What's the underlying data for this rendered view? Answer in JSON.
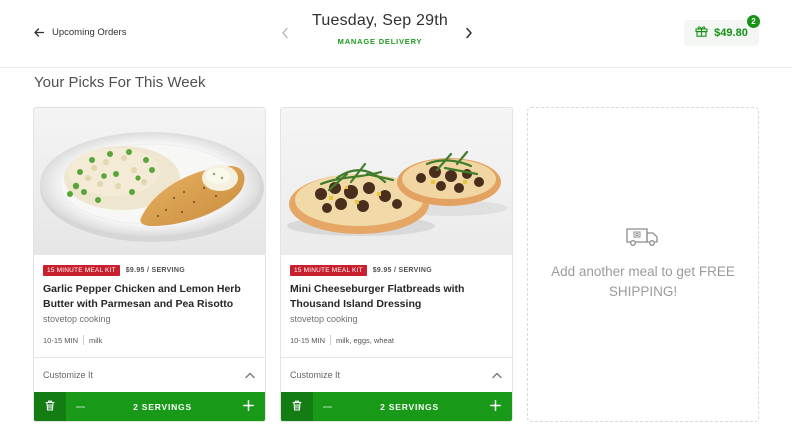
{
  "header": {
    "back_label": "Upcoming Orders",
    "date": "Tuesday, Sep 29th",
    "manage_label": "MANAGE DELIVERY",
    "cart_total": "$49.80",
    "cart_count": "2"
  },
  "section_title": "Your Picks For This Week",
  "meals": [
    {
      "badge": "15 MINUTE MEAL KIT",
      "price": "$9.95 / SERVING",
      "name": "Garlic Pepper Chicken and Lemon Herb Butter with Parmesan and Pea Risotto",
      "subtitle": "stovetop cooking",
      "time": "10-15 MIN",
      "allergens": "milk",
      "customize_label": "Customize It",
      "servings": "2 SERVINGS"
    },
    {
      "badge": "15 MINUTE MEAL KIT",
      "price": "$9.95 / SERVING",
      "name": "Mini Cheeseburger Flatbreads with Thousand Island Dressing",
      "subtitle": "stovetop cooking",
      "time": "10-15 MIN",
      "allergens": "milk, eggs, wheat",
      "customize_label": "Customize It",
      "servings": "2 SERVINGS"
    }
  ],
  "add_meal": {
    "text": "Add another meal to get FREE SHIPPING!"
  },
  "icons": {
    "back": "arrow-left-icon",
    "prev": "chevron-left-icon",
    "next": "chevron-right-icon",
    "cart": "gift-icon",
    "customize": "chevron-up-icon",
    "trash": "trash-icon",
    "minus": "minus-icon",
    "plus": "plus-icon",
    "truck": "delivery-truck-icon"
  },
  "colors": {
    "accent_green": "#189a18",
    "badge_red": "#c8202f",
    "dark_green": "#137c13"
  }
}
